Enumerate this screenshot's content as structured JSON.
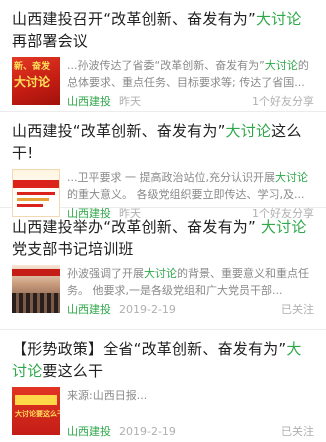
{
  "articles": [
    {
      "title_a": "山西建投召开“改革创新、奋发有为”",
      "title_hl": "大讨论",
      "title_b": "再部署会议",
      "thumb_text_top": "新、奋发",
      "thumb_text_big": "大讨论",
      "summary_a": "...孙波传达了省委“改革创新、奋发有为”",
      "summary_hl": "大讨论",
      "summary_b": "的总体要求、重点任务、目标要求等; 传达了省国...",
      "source": "山西建投",
      "date": "昨天",
      "stat": "1个好友分享"
    },
    {
      "title_a": "山西建投“改革创新、奋发有为”",
      "title_hl": "大讨论",
      "title_b": "这么干!",
      "summary_a": "...卫平要求 一 提高政治站位,充分认识开展",
      "summary_hl": "大讨论",
      "summary_b": "的重大意义。 各级党组织要立即传达、学习,及...",
      "source": "山西建投",
      "date": "昨天",
      "stat": "1个好友分享"
    },
    {
      "title_a": "山西建投举办“改革创新、奋发有为” ",
      "title_hl": "大讨论",
      "title_b": "党支部书记培训班",
      "summary_a": "孙波强调了开展",
      "summary_hl": "大讨论",
      "summary_b": "的背景、重要意义和重点任务。 他要求,一是各级党组和广大党员干部...",
      "source": "山西建投",
      "date": "2019-2-19",
      "stat": "已关注"
    },
    {
      "title_a": "【形势政策】全省“改革创新、奋发有为”",
      "title_hl": "大讨论",
      "title_b": "要这么干",
      "thumb_text_gold": "大讨论要这么干",
      "summary_a": "来源:山西日报...",
      "summary_hl": "",
      "summary_b": "",
      "source": "山西建投",
      "date": "2019-2-19",
      "stat": "已关注"
    }
  ]
}
